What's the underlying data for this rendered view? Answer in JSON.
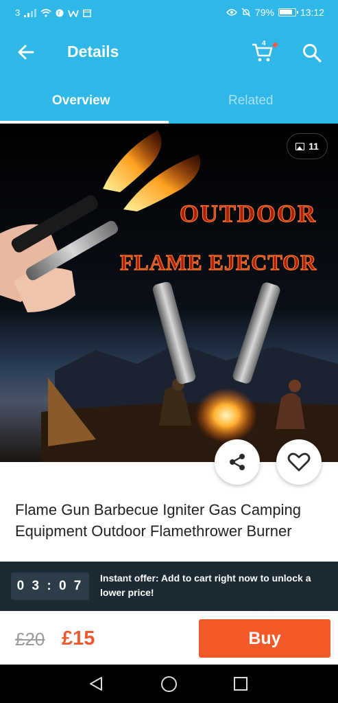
{
  "status_bar": {
    "carrier": "3",
    "battery": "79%",
    "time": "13:12"
  },
  "header": {
    "title": "Details",
    "cart_count": "4"
  },
  "tabs": [
    {
      "label": "Overview",
      "active": true
    },
    {
      "label": "Related",
      "active": false
    }
  ],
  "gallery": {
    "photo_count": "11",
    "image_text_line1": "OUTDOOR",
    "image_text_line2": "FLAME EJECTOR"
  },
  "product": {
    "title": "Flame Gun Barbecue Igniter Gas Camping Equipment Outdoor Flamethrower Burner",
    "original_price": "£20",
    "price": "£15"
  },
  "offer": {
    "timer": "03:07",
    "text": "Instant offer: Add to cart right now to unlock a lower price!"
  },
  "actions": {
    "buy_label": "Buy"
  },
  "colors": {
    "primary": "#2fb7e8",
    "accent": "#f25a2a",
    "offer_bg": "#1b2a33"
  }
}
